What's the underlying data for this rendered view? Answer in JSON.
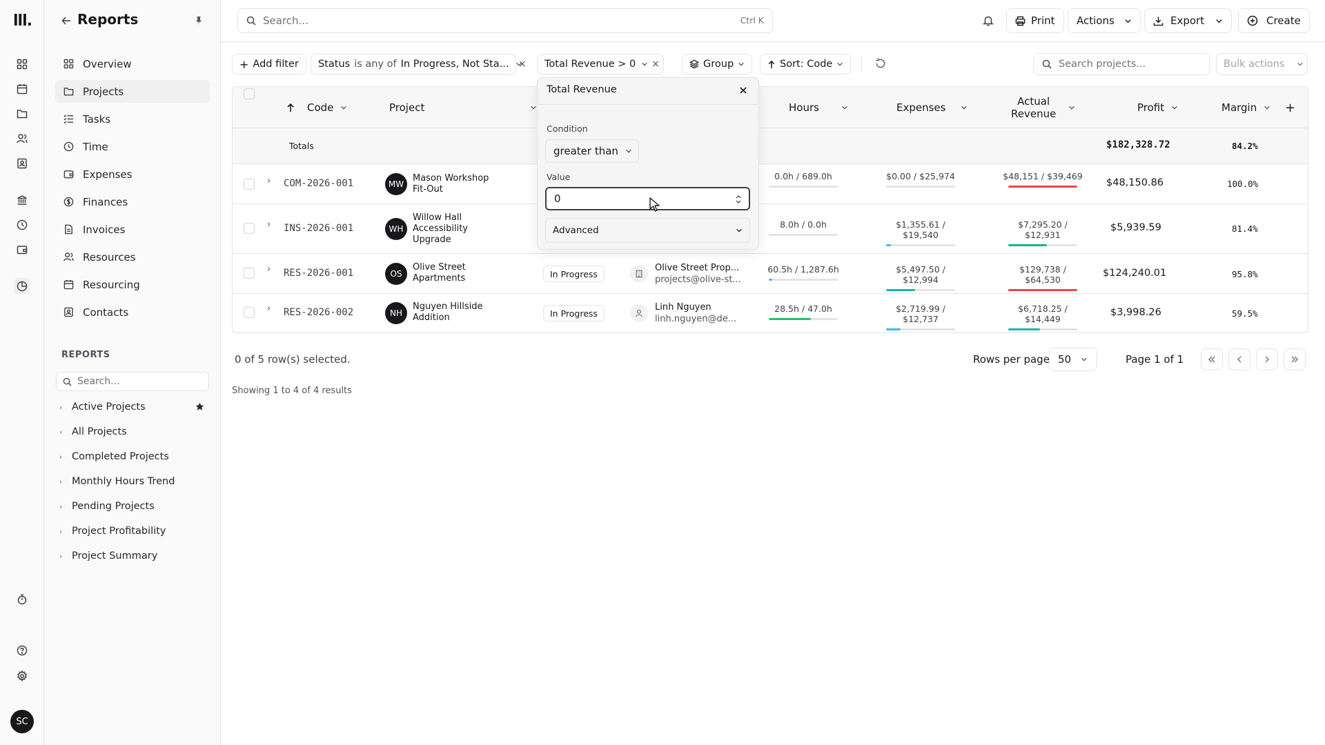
{
  "app": {
    "title": "Reports",
    "user_initials": "SC",
    "logo_text": "lll."
  },
  "sidebar": {
    "items": [
      {
        "label": "Overview",
        "icon": "grid-icon"
      },
      {
        "label": "Projects",
        "icon": "folder-icon",
        "active": true
      },
      {
        "label": "Tasks",
        "icon": "list-icon"
      },
      {
        "label": "Time",
        "icon": "clock-icon"
      },
      {
        "label": "Expenses",
        "icon": "wallet-icon"
      },
      {
        "label": "Finances",
        "icon": "dollar-circle-icon"
      },
      {
        "label": "Invoices",
        "icon": "file-icon"
      },
      {
        "label": "Resources",
        "icon": "users-icon"
      },
      {
        "label": "Resourcing",
        "icon": "calendar-icon"
      },
      {
        "label": "Contacts",
        "icon": "contact-book-icon"
      }
    ],
    "reports_heading": "REPORTS",
    "search_placeholder": "Search...",
    "reports": [
      {
        "label": "Active Projects",
        "starred": true
      },
      {
        "label": "All Projects"
      },
      {
        "label": "Completed Projects"
      },
      {
        "label": "Monthly Hours Trend"
      },
      {
        "label": "Pending Projects"
      },
      {
        "label": "Project Profitability"
      },
      {
        "label": "Project Summary"
      }
    ]
  },
  "topbar": {
    "search_placeholder": "Search...",
    "shortcut": "Ctrl K",
    "print": "Print",
    "actions": "Actions",
    "export": "Export",
    "create": "Create"
  },
  "filters": {
    "add_filter": "Add filter",
    "status_field": "Status",
    "status_op": "is any of",
    "status_value": "In Progress, Not Sta...",
    "revenue_filter": "Total Revenue > 0",
    "group": "Group",
    "sort": "Sort: Code",
    "search_placeholder": "Search projects...",
    "bulk_actions": "Bulk actions"
  },
  "table": {
    "columns": {
      "code": "Code",
      "project": "Project",
      "hours": "Hours",
      "expenses": "Expenses",
      "actual_revenue_1": "Actual",
      "actual_revenue_2": "Revenue",
      "profit": "Profit",
      "margin": "Margin"
    },
    "totals": {
      "label": "Totals",
      "profit": "$182,328.72",
      "margin": "84.2%"
    },
    "rows": [
      {
        "code": "COM-2026-001",
        "initials": "MW",
        "project_1": "Mason Workshop",
        "project_2": "Fit-Out",
        "project_3": "",
        "status": "",
        "client_name": "",
        "client_email": "",
        "hours": "0.0h / 689.0h",
        "hours_pct": 0,
        "hours_color": "#e4e4e7",
        "expenses": "$0.00 / $25,974",
        "expenses_pct": 0,
        "expenses_color": "#38bdf8",
        "revenue": "$48,151 / $39,469",
        "revenue_pct": 100,
        "revenue_color": "#ef4444",
        "profit": "$48,150.86",
        "margin": "100.0%"
      },
      {
        "code": "INS-2026-001",
        "initials": "WH",
        "project_1": "Willow Hall",
        "project_2": "Accessibility",
        "project_3": "Upgrade",
        "status": "",
        "client_name": "",
        "client_email": "",
        "hours": "8.0h / 0.0h",
        "hours_pct": 0,
        "hours_color": "#e4e4e7",
        "expenses": "$1,355.61 / $19,540",
        "expenses_pct": 7,
        "expenses_color": "#38bdf8",
        "revenue": "$7,295.20 / $12,931",
        "revenue_pct": 56,
        "revenue_color": "#10b981",
        "profit": "$5,939.59",
        "margin": "81.4%"
      },
      {
        "code": "RES-2026-001",
        "initials": "OS",
        "project_1": "Olive Street",
        "project_2": "Apartments",
        "project_3": "",
        "status": "In Progress",
        "client_name": "Olive Street Prop...",
        "client_email": "projects@olive-st...",
        "client_icon": "building-icon",
        "hours": "60.5h / 1,287.6h",
        "hours_pct": 5,
        "hours_color": "#60a5fa",
        "expenses": "$5,497.50 / $12,994",
        "expenses_pct": 42,
        "expenses_color": "#14b8a6",
        "revenue": "$129,738 / $64,530",
        "revenue_pct": 100,
        "revenue_color": "#ef4444",
        "profit": "$124,240.01",
        "margin": "95.8%"
      },
      {
        "code": "RES-2026-002",
        "initials": "NH",
        "project_1": "Nguyen Hillside",
        "project_2": "Addition",
        "project_3": "",
        "status": "In Progress",
        "client_name": "Linh Nguyen",
        "client_email": "linh.nguyen@de...",
        "client_icon": "user-icon",
        "hours": "28.5h / 47.0h",
        "hours_pct": 61,
        "hours_color": "#22c55e",
        "expenses": "$2,719.99 / $12,737",
        "expenses_pct": 21,
        "expenses_color": "#38bdf8",
        "revenue": "$6,718.25 / $14,449",
        "revenue_pct": 46,
        "revenue_color": "#14b8a6",
        "profit": "$3,998.26",
        "margin": "59.5%"
      }
    ]
  },
  "footer": {
    "selected": "0 of 5 row(s) selected.",
    "rows_per_page_label": "Rows per page",
    "rows_per_page": "50",
    "page": "Page 1 of 1",
    "showing": "Showing 1 to 4 of 4 results"
  },
  "popover": {
    "title": "Total Revenue",
    "condition_label": "Condition",
    "condition": "greater than",
    "value_label": "Value",
    "value": "0",
    "advanced": "Advanced"
  }
}
